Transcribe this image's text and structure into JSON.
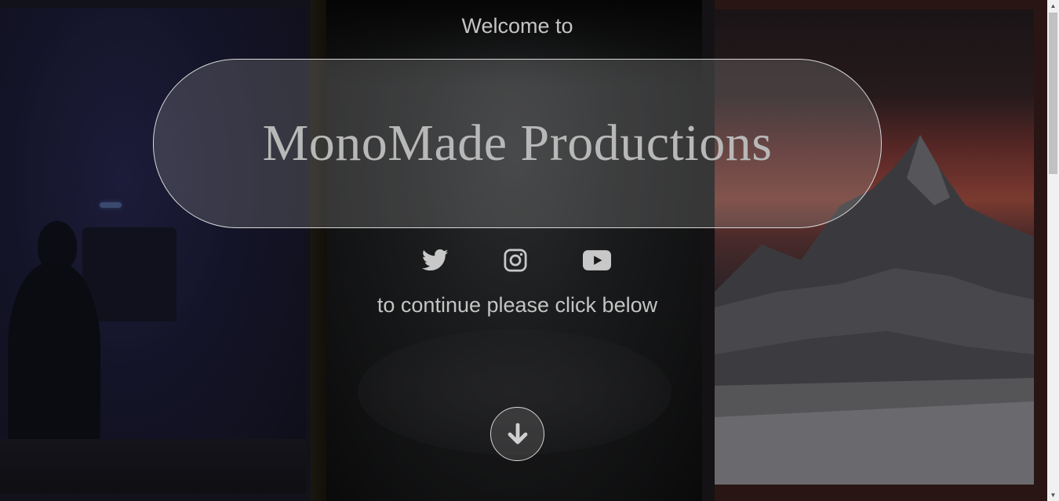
{
  "hero": {
    "welcome_text": "Welcome to",
    "title": "MonoMade Productions",
    "continue_text": "to continue please click below"
  },
  "socials": [
    {
      "name": "Twitter",
      "icon": "twitter-icon"
    },
    {
      "name": "Instagram",
      "icon": "instagram-icon"
    },
    {
      "name": "YouTube",
      "icon": "youtube-icon"
    }
  ],
  "actions": {
    "scroll_down_icon": "arrow-down-icon"
  },
  "colors": {
    "text": "#c4c4c4",
    "pill_border": "#d8d8d8",
    "icon": "#c8c8c8"
  }
}
